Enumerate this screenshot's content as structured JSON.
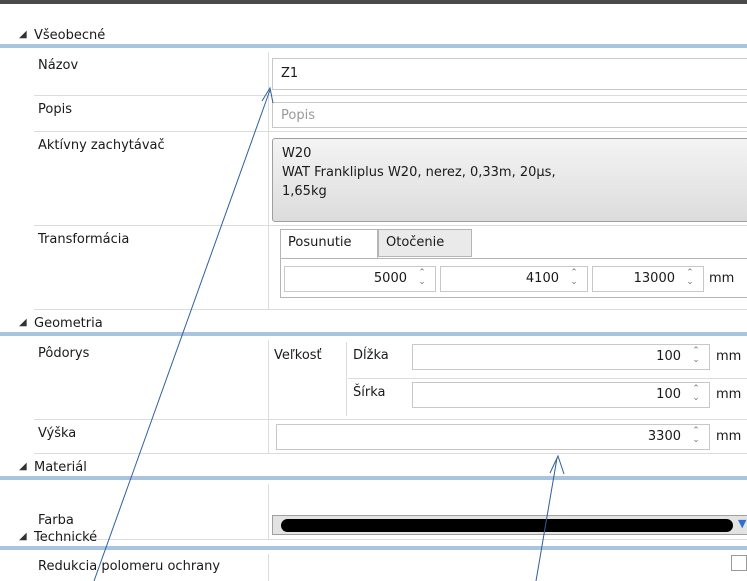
{
  "sections": {
    "general": "Všeobecné",
    "geometry": "Geometria",
    "material": "Materiál",
    "technical": "Technické"
  },
  "general": {
    "name_label": "Názov",
    "name_value": "Z1",
    "description_label": "Popis",
    "description_placeholder": "Popis",
    "active_catcher_label": "Aktívny zachytávač",
    "active_catcher_lines": [
      "W20",
      "WAT Frankliplus W20, nerez, 0,33m, 20µs,",
      "1,65kg"
    ],
    "transformation_label": "Transformácia",
    "tabs": [
      "Posunutie",
      "Otočenie"
    ],
    "translation_values": [
      "5000",
      "4100",
      "13000"
    ],
    "unit": "mm"
  },
  "geometry": {
    "floor_label": "Pôdorys",
    "size_label": "Veľkosť",
    "length_label": "Dĺžka",
    "length_value": "100",
    "width_label": "Šírka",
    "width_value": "100",
    "height_label": "Výška",
    "height_value": "3300",
    "unit": "mm"
  },
  "material": {
    "color_label": "Farba",
    "color_value": "#000000"
  },
  "technical": {
    "protection_radius_reduction_label": "Redukcia polomeru ochrany"
  },
  "colors": {
    "section_underline": "#a9c4e0",
    "top_bar": "#4a4a4a"
  }
}
